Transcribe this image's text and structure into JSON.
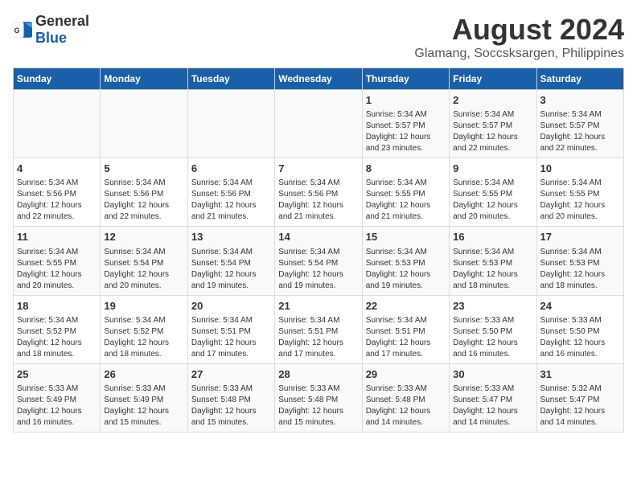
{
  "header": {
    "logo_general": "General",
    "logo_blue": "Blue",
    "title": "August 2024",
    "subtitle": "Glamang, Soccsksargen, Philippines"
  },
  "days_of_week": [
    "Sunday",
    "Monday",
    "Tuesday",
    "Wednesday",
    "Thursday",
    "Friday",
    "Saturday"
  ],
  "weeks": [
    [
      {
        "day": "",
        "info": ""
      },
      {
        "day": "",
        "info": ""
      },
      {
        "day": "",
        "info": ""
      },
      {
        "day": "",
        "info": ""
      },
      {
        "day": "1",
        "info": "Sunrise: 5:34 AM\nSunset: 5:57 PM\nDaylight: 12 hours\nand 23 minutes."
      },
      {
        "day": "2",
        "info": "Sunrise: 5:34 AM\nSunset: 5:57 PM\nDaylight: 12 hours\nand 22 minutes."
      },
      {
        "day": "3",
        "info": "Sunrise: 5:34 AM\nSunset: 5:57 PM\nDaylight: 12 hours\nand 22 minutes."
      }
    ],
    [
      {
        "day": "4",
        "info": "Sunrise: 5:34 AM\nSunset: 5:56 PM\nDaylight: 12 hours\nand 22 minutes."
      },
      {
        "day": "5",
        "info": "Sunrise: 5:34 AM\nSunset: 5:56 PM\nDaylight: 12 hours\nand 22 minutes."
      },
      {
        "day": "6",
        "info": "Sunrise: 5:34 AM\nSunset: 5:56 PM\nDaylight: 12 hours\nand 21 minutes."
      },
      {
        "day": "7",
        "info": "Sunrise: 5:34 AM\nSunset: 5:56 PM\nDaylight: 12 hours\nand 21 minutes."
      },
      {
        "day": "8",
        "info": "Sunrise: 5:34 AM\nSunset: 5:55 PM\nDaylight: 12 hours\nand 21 minutes."
      },
      {
        "day": "9",
        "info": "Sunrise: 5:34 AM\nSunset: 5:55 PM\nDaylight: 12 hours\nand 20 minutes."
      },
      {
        "day": "10",
        "info": "Sunrise: 5:34 AM\nSunset: 5:55 PM\nDaylight: 12 hours\nand 20 minutes."
      }
    ],
    [
      {
        "day": "11",
        "info": "Sunrise: 5:34 AM\nSunset: 5:55 PM\nDaylight: 12 hours\nand 20 minutes."
      },
      {
        "day": "12",
        "info": "Sunrise: 5:34 AM\nSunset: 5:54 PM\nDaylight: 12 hours\nand 20 minutes."
      },
      {
        "day": "13",
        "info": "Sunrise: 5:34 AM\nSunset: 5:54 PM\nDaylight: 12 hours\nand 19 minutes."
      },
      {
        "day": "14",
        "info": "Sunrise: 5:34 AM\nSunset: 5:54 PM\nDaylight: 12 hours\nand 19 minutes."
      },
      {
        "day": "15",
        "info": "Sunrise: 5:34 AM\nSunset: 5:53 PM\nDaylight: 12 hours\nand 19 minutes."
      },
      {
        "day": "16",
        "info": "Sunrise: 5:34 AM\nSunset: 5:53 PM\nDaylight: 12 hours\nand 18 minutes."
      },
      {
        "day": "17",
        "info": "Sunrise: 5:34 AM\nSunset: 5:53 PM\nDaylight: 12 hours\nand 18 minutes."
      }
    ],
    [
      {
        "day": "18",
        "info": "Sunrise: 5:34 AM\nSunset: 5:52 PM\nDaylight: 12 hours\nand 18 minutes."
      },
      {
        "day": "19",
        "info": "Sunrise: 5:34 AM\nSunset: 5:52 PM\nDaylight: 12 hours\nand 18 minutes."
      },
      {
        "day": "20",
        "info": "Sunrise: 5:34 AM\nSunset: 5:51 PM\nDaylight: 12 hours\nand 17 minutes."
      },
      {
        "day": "21",
        "info": "Sunrise: 5:34 AM\nSunset: 5:51 PM\nDaylight: 12 hours\nand 17 minutes."
      },
      {
        "day": "22",
        "info": "Sunrise: 5:34 AM\nSunset: 5:51 PM\nDaylight: 12 hours\nand 17 minutes."
      },
      {
        "day": "23",
        "info": "Sunrise: 5:33 AM\nSunset: 5:50 PM\nDaylight: 12 hours\nand 16 minutes."
      },
      {
        "day": "24",
        "info": "Sunrise: 5:33 AM\nSunset: 5:50 PM\nDaylight: 12 hours\nand 16 minutes."
      }
    ],
    [
      {
        "day": "25",
        "info": "Sunrise: 5:33 AM\nSunset: 5:49 PM\nDaylight: 12 hours\nand 16 minutes."
      },
      {
        "day": "26",
        "info": "Sunrise: 5:33 AM\nSunset: 5:49 PM\nDaylight: 12 hours\nand 15 minutes."
      },
      {
        "day": "27",
        "info": "Sunrise: 5:33 AM\nSunset: 5:48 PM\nDaylight: 12 hours\nand 15 minutes."
      },
      {
        "day": "28",
        "info": "Sunrise: 5:33 AM\nSunset: 5:48 PM\nDaylight: 12 hours\nand 15 minutes."
      },
      {
        "day": "29",
        "info": "Sunrise: 5:33 AM\nSunset: 5:48 PM\nDaylight: 12 hours\nand 14 minutes."
      },
      {
        "day": "30",
        "info": "Sunrise: 5:33 AM\nSunset: 5:47 PM\nDaylight: 12 hours\nand 14 minutes."
      },
      {
        "day": "31",
        "info": "Sunrise: 5:32 AM\nSunset: 5:47 PM\nDaylight: 12 hours\nand 14 minutes."
      }
    ]
  ]
}
